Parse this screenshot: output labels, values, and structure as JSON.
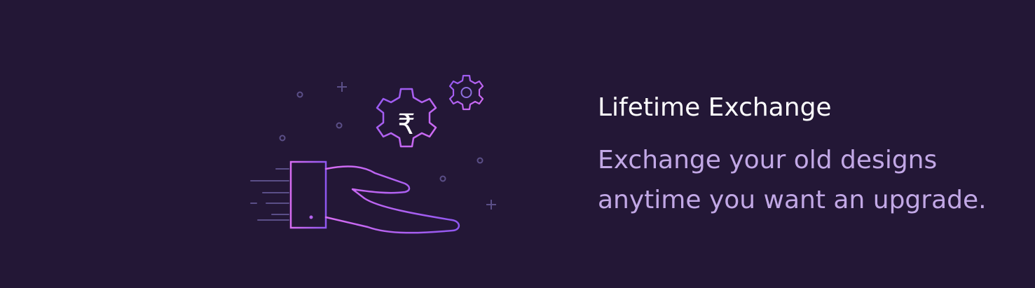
{
  "feature": {
    "title": "Lifetime Exchange",
    "description_line1": "Exchange your old designs",
    "description_line2": "anytime you want an upgrade.",
    "currency_symbol": "₹",
    "illustration_icon": "hand-holding-gear-icon"
  },
  "colors": {
    "background": "#231736",
    "title": "#ffffff",
    "description": "#c2a8e6",
    "accent_purple": "#9b5cf0",
    "accent_pink": "#d76df2"
  }
}
